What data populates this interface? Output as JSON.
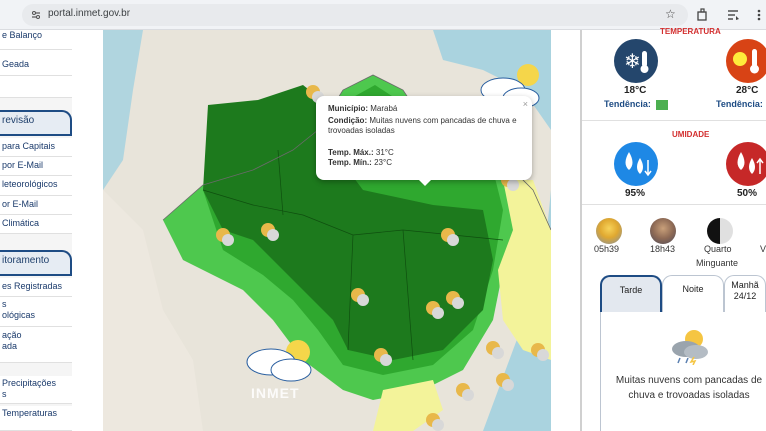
{
  "browser": {
    "url": "portal.inmet.gov.br"
  },
  "sidebar": {
    "items": [
      {
        "label": "e Balanço"
      },
      {
        "label": "Geada"
      },
      {
        "label": ""
      }
    ],
    "section1": {
      "title": "revisão"
    },
    "section1_items": [
      {
        "label": " para Capitais"
      },
      {
        "label": " por E-Mail"
      },
      {
        "label": "leteorológicos"
      },
      {
        "label": "or E-Mail"
      },
      {
        "label": " Climática"
      }
    ],
    "section2": {
      "title": "itoramento"
    },
    "section2_items": [
      {
        "label": "es Registradas"
      },
      {
        "label": "s"
      },
      {
        "label": "ológicas"
      },
      {
        "label": "ação"
      },
      {
        "label": "ada"
      },
      {
        "label": " Precipitações"
      },
      {
        "label": "s"
      },
      {
        "label": " Temperaturas"
      }
    ]
  },
  "map": {
    "watermark": "INMET",
    "popup": {
      "municipio_label": "Município:",
      "municipio_value": "Marabá",
      "condicao_label": "Condição:",
      "condicao_value": "Muitas nuvens com pancadas de chuva e trovoadas isoladas",
      "tmax_label": "Temp. Máx.:",
      "tmax_value": "31°C",
      "tmin_label": "Temp. Mín.:",
      "tmin_value": "23°C",
      "close": "×"
    }
  },
  "panel": {
    "temperature_title": "TEMPERATURA",
    "temp_min": "18°C",
    "temp_max": "28°C",
    "trend_label": "Tendência:",
    "trend_label2": "Tendência:",
    "humidity_title": "UMIDADE",
    "hum_max": "95%",
    "hum_min": "50%",
    "sunrise": "05h39",
    "sunset": "18h43",
    "moon": "Quarto",
    "moon_extra": "V",
    "moon_phase": "Minguante",
    "tabs": [
      {
        "label": "Tarde"
      },
      {
        "label": "Noite"
      },
      {
        "label": "Manhã",
        "sub": "24/12"
      }
    ],
    "forecast_text": "Muitas nuvens com pancadas de chuva e trovoadas isoladas"
  },
  "colors": {
    "dark_green": "#1d7a1d",
    "mid_green": "#2fa82f",
    "light_green": "#4ec84e",
    "yellow": "#f3f39a",
    "sea": "#aad3df",
    "land": "#e9e6dd",
    "brand_blue": "#1e4c84",
    "red": "#d32f2f"
  }
}
